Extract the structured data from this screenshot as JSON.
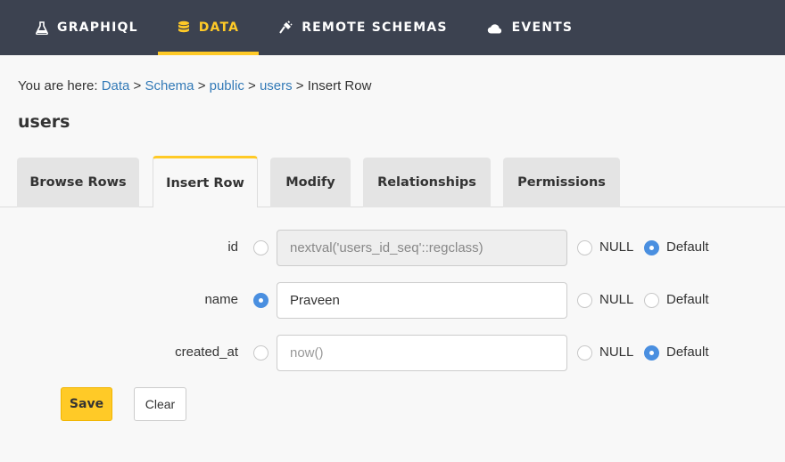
{
  "nav": {
    "graphiql": "GRAPHIQL",
    "data": "DATA",
    "remote_schemas": "REMOTE SCHEMAS",
    "events": "EVENTS",
    "active_color": "#ffca27"
  },
  "breadcrumb": {
    "prefix": "You are here: ",
    "items": [
      "Data",
      "Schema",
      "public",
      "users"
    ],
    "current": "Insert Row",
    "separator": ">"
  },
  "page_title": "users",
  "tabs": [
    "Browse Rows",
    "Insert Row",
    "Modify",
    "Relationships",
    "Permissions"
  ],
  "active_tab": "Insert Row",
  "form": {
    "rows": [
      {
        "label": "id",
        "value_selected": false,
        "value": "nextval('users_id_seq'::regclass)",
        "disabled": true,
        "null_selected": false,
        "default_selected": true
      },
      {
        "label": "name",
        "value_selected": true,
        "value": "Praveen",
        "disabled": false,
        "null_selected": false,
        "default_selected": false
      },
      {
        "label": "created_at",
        "value_selected": false,
        "placeholder": "now()",
        "disabled": false,
        "null_selected": false,
        "default_selected": true
      }
    ],
    "null_label": "NULL",
    "default_label": "Default"
  },
  "buttons": {
    "save": "Save",
    "clear": "Clear"
  },
  "icons": {
    "graphiql": "flask-icon",
    "data": "database-icon",
    "remote_schemas": "plug-icon",
    "events": "cloud-icon"
  }
}
